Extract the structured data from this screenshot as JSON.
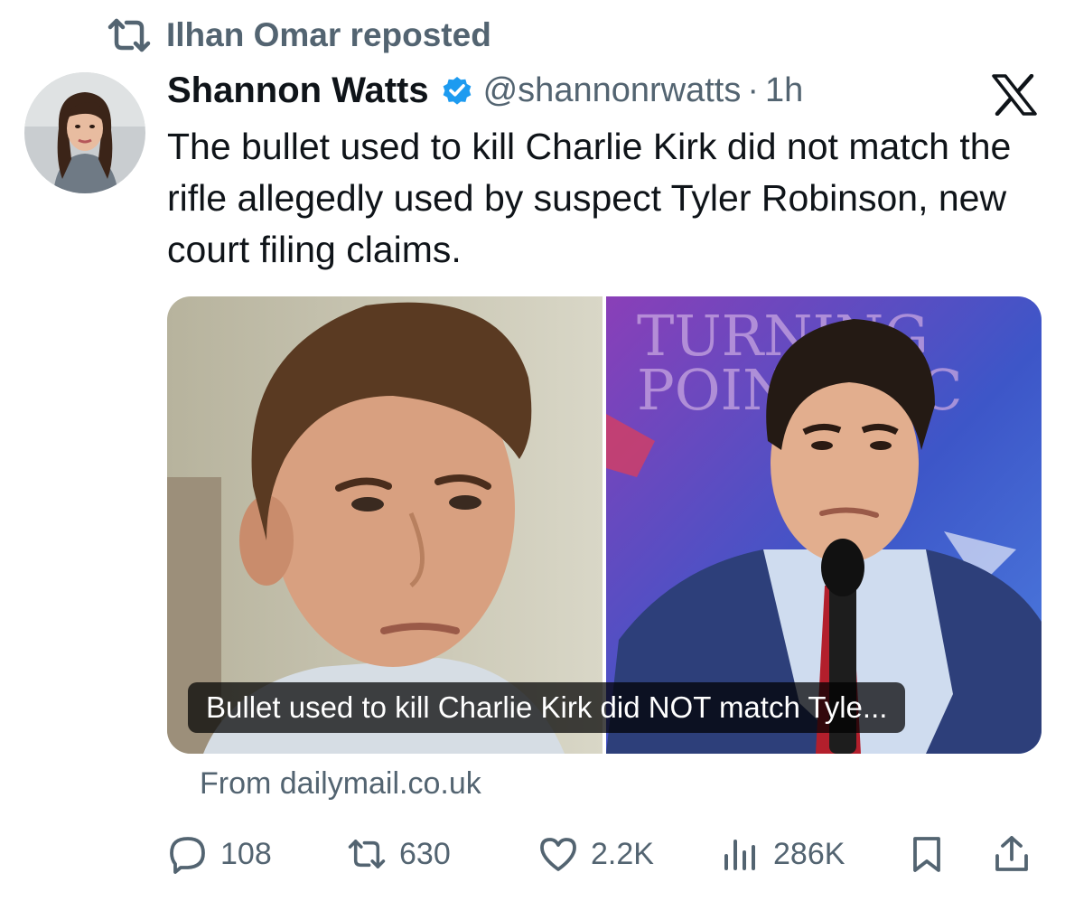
{
  "repost": {
    "label": "Ilhan Omar reposted",
    "icon": "repost-icon"
  },
  "author": {
    "name": "Shannon Watts",
    "handle": "@shannonrwatts",
    "separator": "·",
    "time": "1h",
    "verified_icon": "verified-badge-icon",
    "verified_color": "#1d9bf0"
  },
  "platform_icon": "x-logo-icon",
  "tweet": {
    "text": "The bullet used to kill Charlie Kirk did not match the rifle allegedly used by suspect Tyler Robinson, new court filing claims."
  },
  "link_card": {
    "caption": "Bullet used to kill Charlie Kirk did NOT match Tyle...",
    "source": "From dailymail.co.uk",
    "background_text": "TURNING POINT PAC"
  },
  "actions": {
    "replies": "108",
    "reposts": "630",
    "likes": "2.2K",
    "views": "286K",
    "icons": [
      "reply-icon",
      "repost-icon",
      "like-icon",
      "views-icon",
      "bookmark-icon",
      "share-icon"
    ]
  },
  "colors": {
    "text": "#0f1419",
    "secondary": "#536471",
    "accent": "#1d9bf0"
  }
}
